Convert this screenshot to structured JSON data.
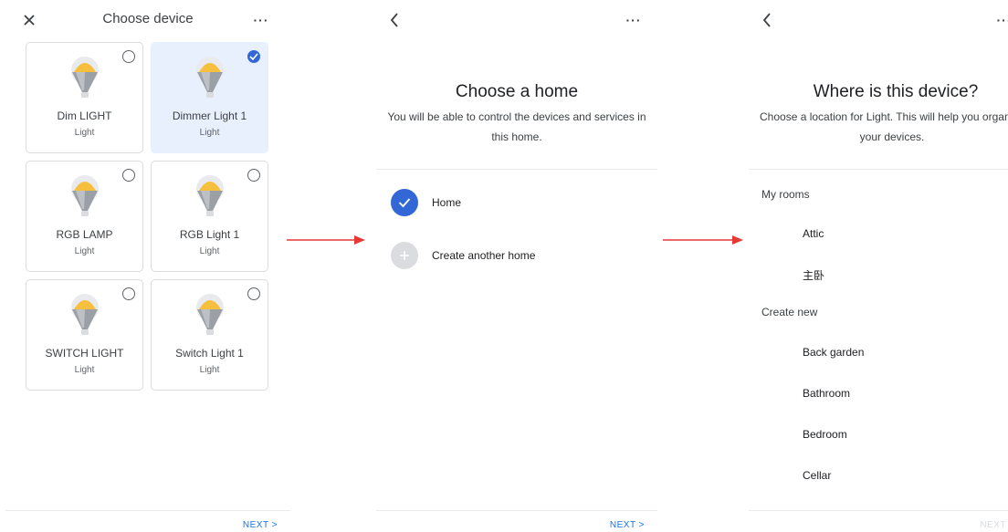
{
  "screen1": {
    "title": "Choose device",
    "close_icon": "close-icon",
    "more_icon": "more-horiz-icon",
    "devices": [
      {
        "name": "Dim LIGHT",
        "type": "Light",
        "selected": false
      },
      {
        "name": "Dimmer Light 1",
        "type": "Light",
        "selected": true
      },
      {
        "name": "RGB LAMP",
        "type": "Light",
        "selected": false
      },
      {
        "name": "RGB Light 1",
        "type": "Light",
        "selected": false
      },
      {
        "name": "SWITCH LIGHT",
        "type": "Light",
        "selected": false
      },
      {
        "name": "Switch Light 1",
        "type": "Light",
        "selected": false
      }
    ],
    "next_label": "NEXT  >"
  },
  "screen2": {
    "heading": "Choose a home",
    "subtitle": "You will be able to control the devices and services in this home.",
    "options": [
      {
        "label": "Home",
        "selected": true
      },
      {
        "label": "Create another home",
        "selected": false
      }
    ],
    "next_label": "NEXT  >"
  },
  "screen3": {
    "heading": "Where is this device?",
    "subtitle": "Choose a location for Light. This will help you organize your devices.",
    "my_rooms_label": "My rooms",
    "my_rooms": [
      "Attic",
      "主卧"
    ],
    "create_new_label": "Create new",
    "new_rooms": [
      "Back garden",
      "Bathroom",
      "Bedroom",
      "Cellar"
    ],
    "next_label": "NEXT"
  },
  "colors": {
    "accent": "#3367d6",
    "link": "#1a73e8",
    "selected_card": "#e8f0fe",
    "arrow": "#e53935",
    "bulb_yellow": "#f6bf3d"
  }
}
